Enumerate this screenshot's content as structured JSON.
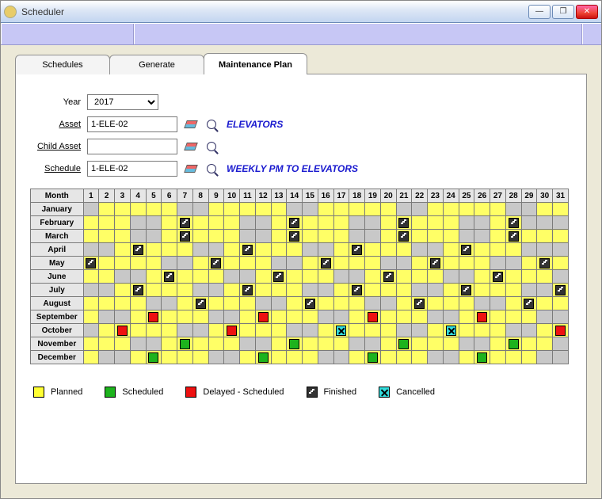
{
  "window": {
    "title": "Scheduler"
  },
  "tabs": [
    {
      "label": "Schedules",
      "active": false
    },
    {
      "label": "Generate",
      "active": false
    },
    {
      "label": "Maintenance Plan",
      "active": true
    }
  ],
  "form": {
    "year_label": "Year",
    "year_value": "2017",
    "asset_label": "Asset",
    "asset_value": "1-ELE-02",
    "asset_desc": "ELEVATORS",
    "child_label": "Child Asset",
    "child_value": "",
    "schedule_label": "Schedule",
    "schedule_value": "1-ELE-02",
    "schedule_desc": "WEEKLY PM TO ELEVATORS"
  },
  "calendar": {
    "month_header": "Month",
    "months": [
      "January",
      "February",
      "March",
      "April",
      "May",
      "June",
      "July",
      "August",
      "September",
      "October",
      "November",
      "December"
    ],
    "start_dow": [
      0,
      3,
      3,
      6,
      1,
      4,
      6,
      2,
      5,
      0,
      3,
      5
    ],
    "days_in_month": [
      31,
      28,
      31,
      30,
      31,
      30,
      31,
      31,
      30,
      31,
      30,
      31
    ],
    "events": {
      "February": [
        [
          7,
          "finished"
        ],
        [
          14,
          "finished"
        ],
        [
          21,
          "finished"
        ],
        [
          28,
          "finished"
        ]
      ],
      "March": [
        [
          7,
          "finished"
        ],
        [
          14,
          "finished"
        ],
        [
          21,
          "finished"
        ],
        [
          28,
          "finished"
        ]
      ],
      "April": [
        [
          4,
          "finished"
        ],
        [
          11,
          "finished"
        ],
        [
          18,
          "finished"
        ],
        [
          25,
          "finished"
        ]
      ],
      "May": [
        [
          1,
          "finished"
        ],
        [
          9,
          "finished"
        ],
        [
          16,
          "finished"
        ],
        [
          23,
          "finished"
        ],
        [
          30,
          "finished"
        ]
      ],
      "June": [
        [
          6,
          "finished"
        ],
        [
          13,
          "finished"
        ],
        [
          20,
          "finished"
        ],
        [
          27,
          "finished"
        ]
      ],
      "July": [
        [
          4,
          "finished"
        ],
        [
          11,
          "finished"
        ],
        [
          18,
          "finished"
        ],
        [
          25,
          "finished"
        ],
        [
          31,
          "finished"
        ]
      ],
      "August": [
        [
          8,
          "finished"
        ],
        [
          15,
          "finished"
        ],
        [
          22,
          "finished"
        ],
        [
          29,
          "finished"
        ]
      ],
      "September": [
        [
          5,
          "delayed"
        ],
        [
          12,
          "delayed"
        ],
        [
          19,
          "delayed"
        ],
        [
          26,
          "delayed"
        ]
      ],
      "October": [
        [
          3,
          "delayed"
        ],
        [
          10,
          "delayed"
        ],
        [
          17,
          "cancelled"
        ],
        [
          24,
          "cancelled"
        ],
        [
          31,
          "delayed"
        ]
      ],
      "November": [
        [
          7,
          "scheduled"
        ],
        [
          14,
          "scheduled"
        ],
        [
          21,
          "scheduled"
        ],
        [
          28,
          "scheduled"
        ]
      ],
      "December": [
        [
          5,
          "scheduled"
        ],
        [
          12,
          "scheduled"
        ],
        [
          19,
          "scheduled"
        ],
        [
          26,
          "scheduled"
        ]
      ]
    }
  },
  "legend": {
    "planned": "Planned",
    "scheduled": "Scheduled",
    "delayed": "Delayed - Scheduled",
    "finished": "Finished",
    "cancelled": "Cancelled"
  }
}
